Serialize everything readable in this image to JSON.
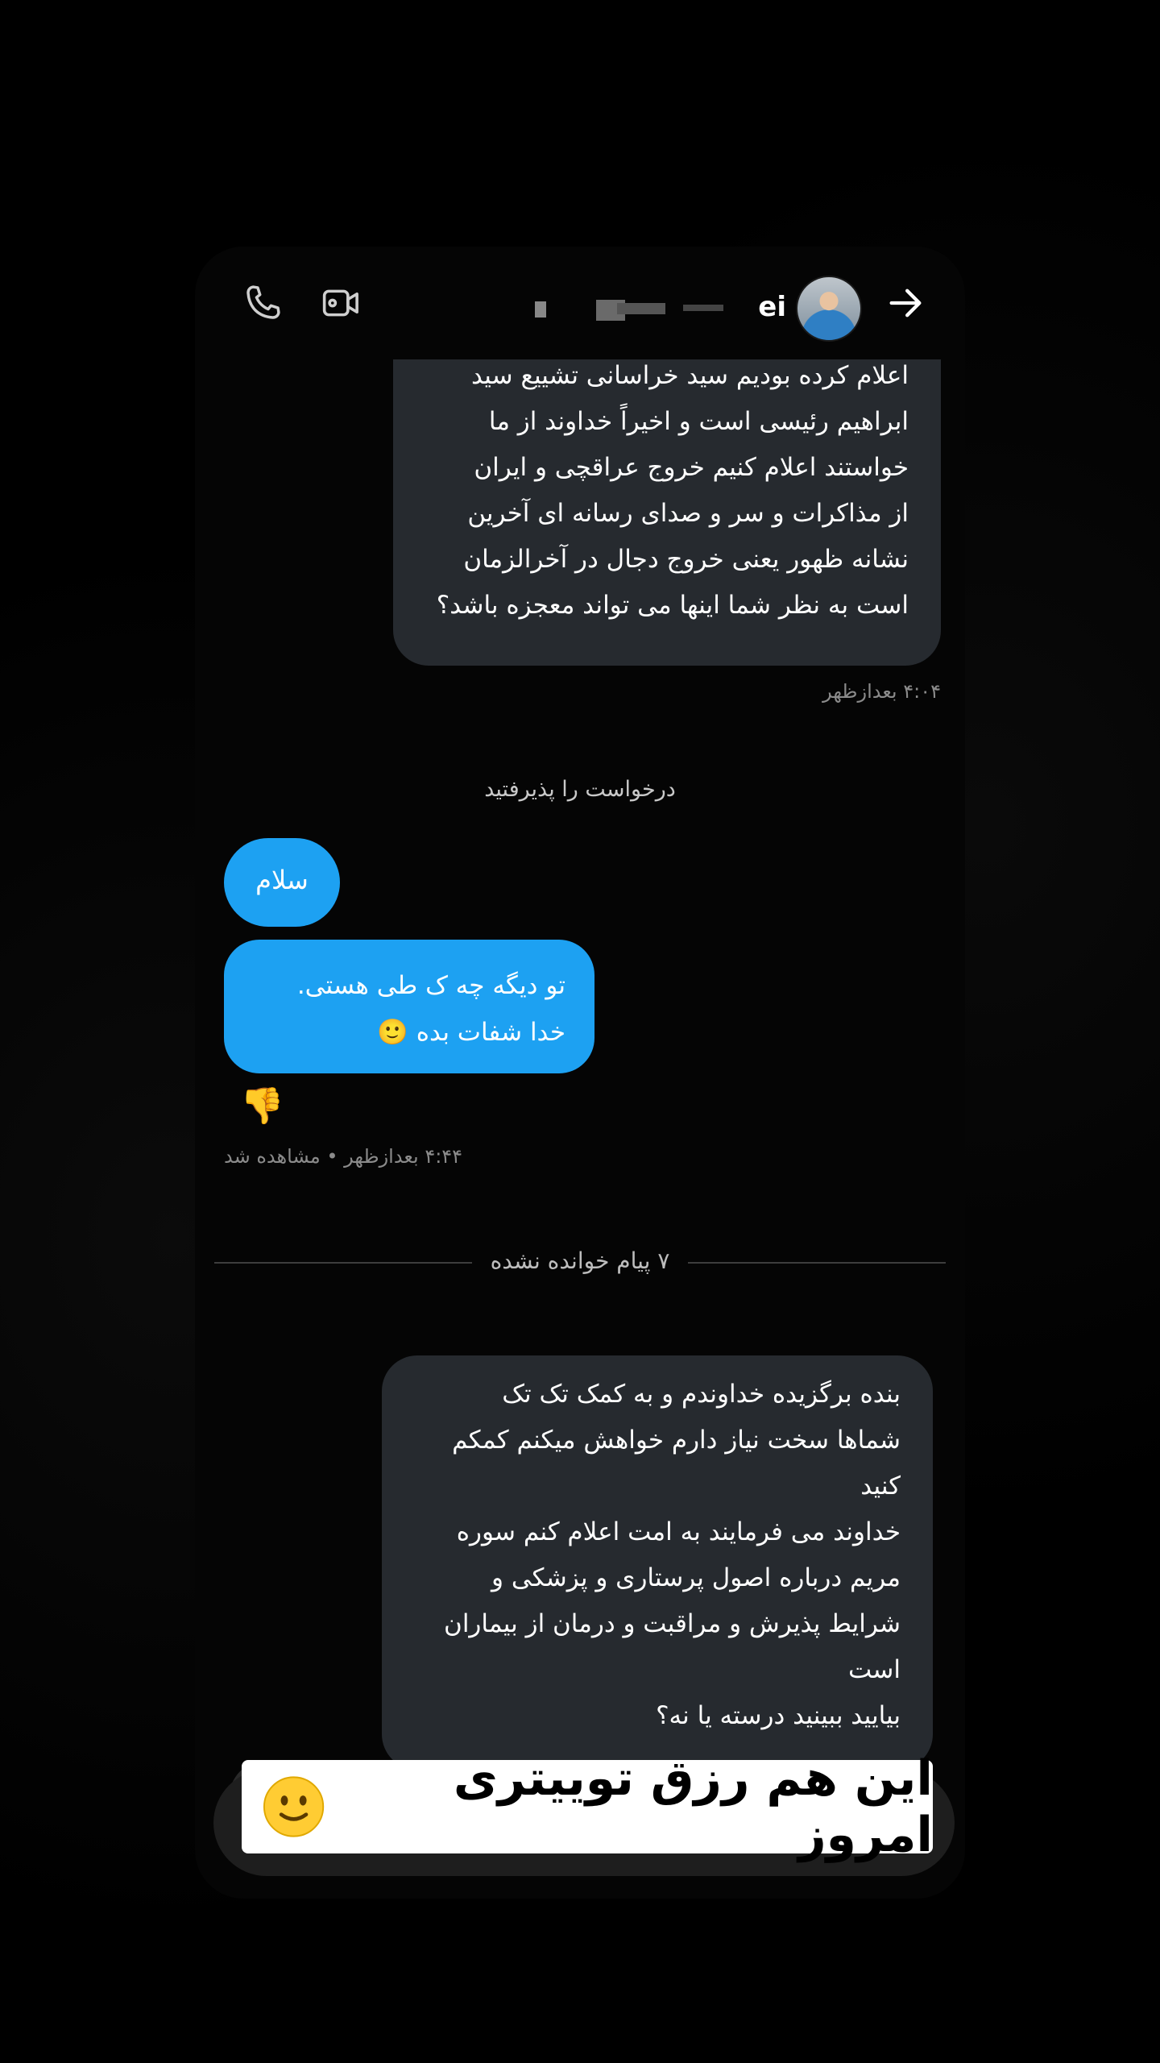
{
  "header": {
    "username": "ei",
    "call_icon": "phone-icon",
    "video_icon": "video-camera-icon",
    "back_icon": "arrow-right-icon"
  },
  "messages": {
    "msg1_text": "اعلام کرده بودیم سید خراسانی تشییع سید\nابراهیم رئیسی است و اخیراً خداوند از ما\nخواستند اعلام کنیم خروج عراقچی و ایران\nاز مذاکرات و سر و صدای رسانه ای آخرین\nنشانه ظهور یعنی خروج دجال در آخرالزمان\nاست به نظر شما اینها می تواند معجزه باشد؟",
    "msg1_time": "۴:۰۴ بعدازظهر",
    "accepted_notice": "درخواست را پذیرفتید",
    "out_salam": "سلام",
    "out_reply": "تو دیگه چه ک  طی هستی.\nخدا شفات بده 🙂",
    "reaction": "👎",
    "out_time": "۴:۴۴ بعدازظهر • مشاهده شد",
    "unread_divider": "۷ پیام خوانده نشده",
    "msg3_text": "بنده برگزیده خداوندم و به کمک تک تک\nشماها سخت نیاز دارم خواهش میکنم کمکم\nکنید\nخداوند می فرمایند به امت اعلام کنم سوره\nمریم درباره اصول پرستاری و پزشکی و\nشرایط پذیرش و  مراقبت و درمان  از بیماران\nاست\nبیایید ببینید درسته یا نه؟"
  },
  "caption": {
    "text": "این هم رزق توییتری امروز",
    "emoji_icon": "slightly-smiling-face-icon"
  },
  "colors": {
    "background": "#000000",
    "incoming_bubble": "#262a2f",
    "outgoing_bubble": "#1da1f2"
  }
}
